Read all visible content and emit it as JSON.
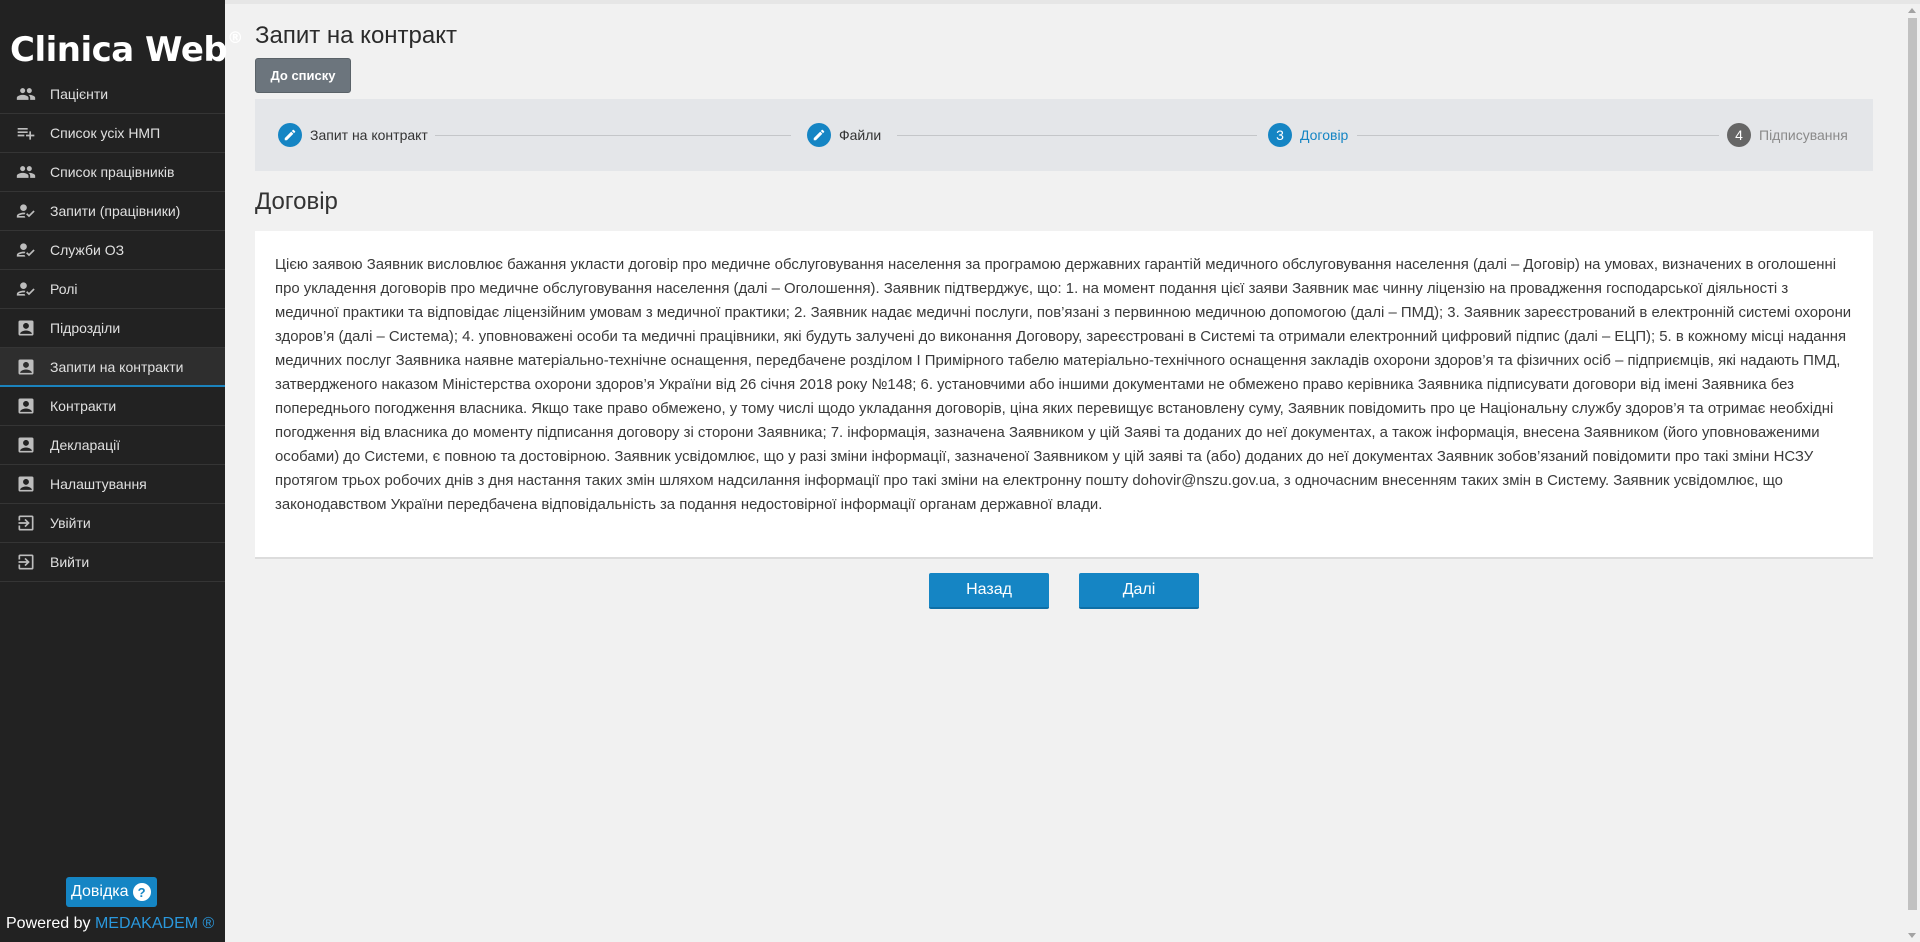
{
  "brand": {
    "name": "Clinica Web",
    "mark": "®"
  },
  "sidebar": {
    "items": [
      {
        "label": "Пацієнти",
        "icon": "people-icon"
      },
      {
        "label": "Список усіх НМП",
        "icon": "playlist-add-icon"
      },
      {
        "label": "Список працівників",
        "icon": "people-icon"
      },
      {
        "label": "Запити (працівники)",
        "icon": "person-check-icon"
      },
      {
        "label": "Служби ОЗ",
        "icon": "person-check-icon"
      },
      {
        "label": "Ролі",
        "icon": "person-check-icon"
      },
      {
        "label": "Підрозділи",
        "icon": "contact-card-icon"
      },
      {
        "label": "Запити на контракти",
        "icon": "contact-card-icon",
        "active": true
      },
      {
        "label": "Контракти",
        "icon": "contact-card-icon"
      },
      {
        "label": "Декларації",
        "icon": "contact-card-icon"
      },
      {
        "label": "Налаштування",
        "icon": "contact-card-icon"
      },
      {
        "label": "Увійти",
        "icon": "login-icon"
      },
      {
        "label": "Вийти",
        "icon": "logout-icon"
      }
    ],
    "help_label": "Довідка",
    "help_icon": "?",
    "powered_prefix": "Powered by",
    "powered_link": "MEDAKADEM ®"
  },
  "header": {
    "title": "Запит на контракт",
    "back_to_list": "До списку"
  },
  "stepper": {
    "steps": [
      {
        "label": "Запит на контракт",
        "state": "done",
        "marker": "pencil-icon"
      },
      {
        "label": "Файли",
        "state": "done",
        "marker": "pencil-icon"
      },
      {
        "label": "Договір",
        "state": "active",
        "marker": "3"
      },
      {
        "label": "Підписування",
        "state": "pending",
        "marker": "4"
      }
    ]
  },
  "contract": {
    "title": "Договір",
    "text": "Цією заявою Заявник висловлює бажання укласти договір про медичне обслуговування населення за програмою державних гарантій медичного обслуговування населення (далі – Договір) на умовах, визначених в оголошенні про укладення договорів про медичне обслуговування населення (далі – Оголошення). Заявник підтверджує, що: 1. на момент подання цієї заяви Заявник має чинну ліцензію на провадження господарської діяльності з медичної практики та відповідає ліцензійним умовам з медичної практики; 2. Заявник надає медичні послуги, пов’язані з первинною медичною допомогою (далі – ПМД); 3. Заявник зареєстрований в електронній системі охорони здоров’я (далі – Система); 4. уповноважені особи та медичні працівники, які будуть залучені до виконання Договору, зареєстровані в Системі та отримали електронний цифровий підпис (далі – ЕЦП); 5. в кожному місці надання медичних послуг Заявника наявне матеріально-технічне оснащення, передбачене розділом I Примірного табелю матеріально-технічного оснащення закладів охорони здоров’я та фізичних осіб – підприємців, які надають ПМД, затвердженого наказом Міністерства охорони здоров’я України від 26 січня 2018 року №148; 6. установчими або іншими документами не обмежено право керівника Заявника підписувати договори від імені Заявника без попереднього погодження власника. Якщо таке право обмежено, у тому числі щодо укладання договорів, ціна яких перевищує встановлену суму, Заявник повідомить про це Національну службу здоров’я та отримає необхідні погодження від власника до моменту підписання договору зі сторони Заявника; 7. інформація, зазначена Заявником у цій Заяві та доданих до неї документах, а також інформація, внесена Заявником (його уповноваженими особами) до Системи, є повною та достовірною. Заявник усвідомлює, що у разі зміни інформації, зазначеної Заявником у цій заяві та (або) доданих до неї документах Заявник зобов’язаний повідомити про такі зміни НСЗУ протягом трьох робочих днів з дня настання таких змін шляхом надсилання інформації про такі зміни на електронну пошту dohovir@nszu.gov.ua, з одночасним внесенням таких змін в Систему. Заявник усвідомлює, що законодавством України передбачена відповідальність за подання недостовірної інформації органам державної влади."
  },
  "actions": {
    "back": "Назад",
    "next": "Далі"
  },
  "colors": {
    "sidebar_bg": "#222222",
    "accent": "#1585c4",
    "secondary_button": "#6c757d"
  }
}
